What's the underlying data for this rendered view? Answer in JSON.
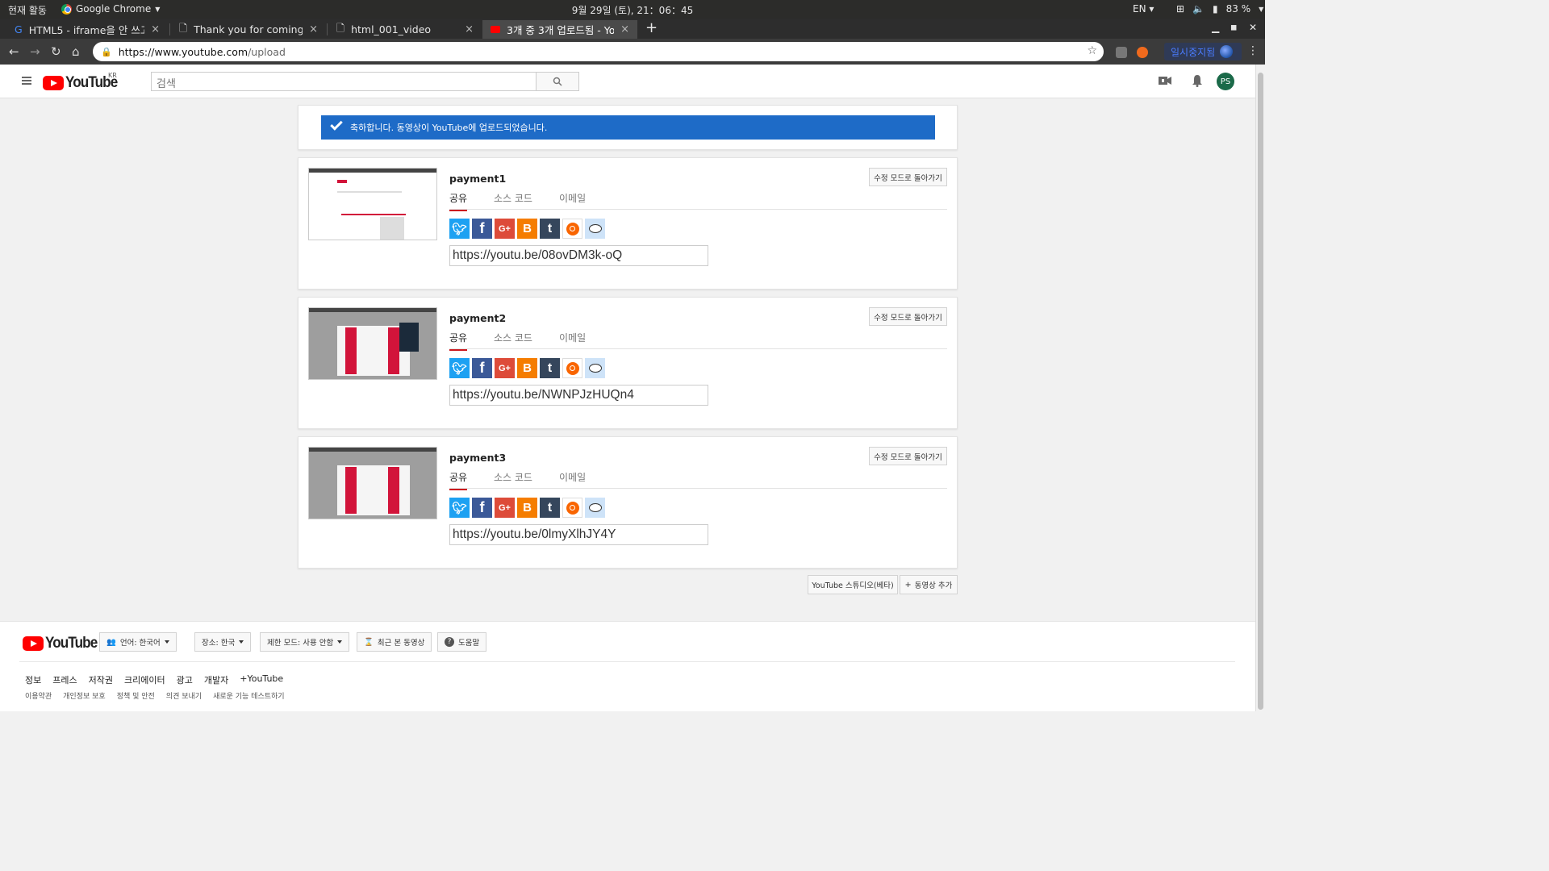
{
  "os": {
    "activities": "현재 활동",
    "app_name": "Google Chrome",
    "clock": "9월 29일 (토), 21：06：45",
    "lang": "EN",
    "battery": "83 %"
  },
  "browser": {
    "tabs": [
      {
        "title": "HTML5 - iframe을 안 쓰고 C"
      },
      {
        "title": "Thank you for coming"
      },
      {
        "title": "html_001_video"
      },
      {
        "title": "3개 중 3개 업로드됨 - YouTu"
      }
    ],
    "url_host": "https://www.youtube.com",
    "url_path": "/upload",
    "profile_label": "일시중지됨"
  },
  "masthead": {
    "logo": "YouTube",
    "region": "KR",
    "search_placeholder": "검색",
    "avatar_initials": "PS"
  },
  "banner": {
    "message": "축하합니다. 동영상이 YouTube에 업로드되었습니다."
  },
  "tabs_labels": {
    "share": "공유",
    "embed": "소스 코드",
    "email": "이메일"
  },
  "edit_label": "수정 모드로 돌아가기",
  "videos": [
    {
      "title": "payment1",
      "url": "https://youtu.be/08ovDM3k-oQ"
    },
    {
      "title": "payment2",
      "url": "https://youtu.be/NWNPJzHUQn4"
    },
    {
      "title": "payment3",
      "url": "https://youtu.be/0lmyXlhJY4Y"
    }
  ],
  "share_icons": [
    "twitter-icon",
    "facebook-icon",
    "google-plus-icon",
    "blogger-icon",
    "tumblr-icon",
    "odnoklassniki-icon",
    "reddit-icon"
  ],
  "actions": {
    "studio": "YouTube 스튜디오(베타)",
    "add_video": "동영상 추가"
  },
  "footer": {
    "logo": "YouTube",
    "language": "언어: 한국어",
    "location": "장소: 한국",
    "restricted": "제한 모드: 사용 안함",
    "history": "최근 본 동영상",
    "help": "도움말",
    "links_primary": [
      "정보",
      "프레스",
      "저작권",
      "크리에이터",
      "광고",
      "개발자",
      "+YouTube"
    ],
    "links_secondary": [
      "이용약관",
      "개인정보 보호",
      "정책 및 안전",
      "의견 보내기",
      "새로운 기능 테스트하기"
    ]
  },
  "colors": {
    "banner": "#1e6bc7",
    "brand_red": "#ff0000",
    "tab_underline": "#cc181e"
  }
}
